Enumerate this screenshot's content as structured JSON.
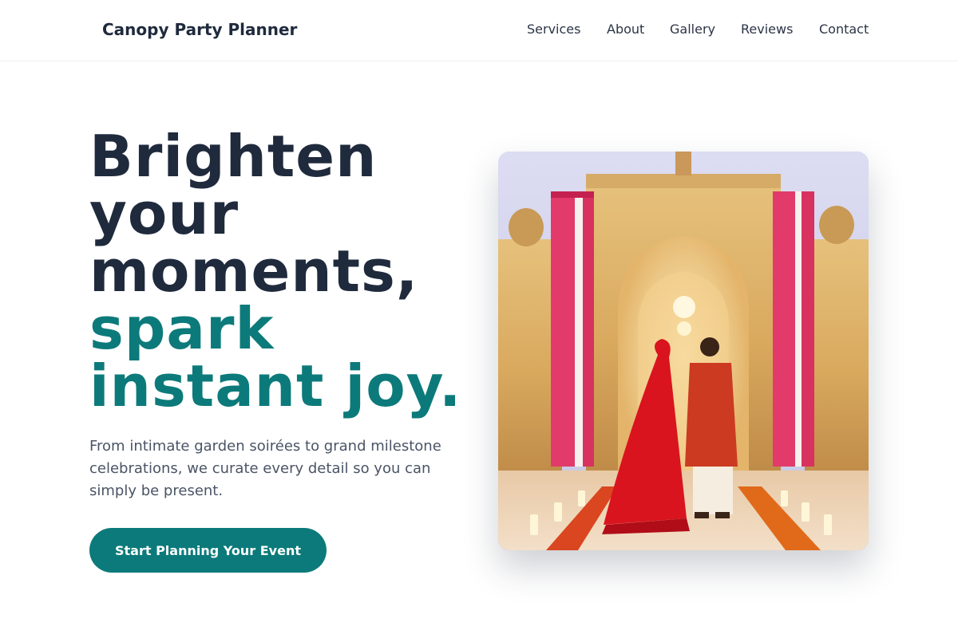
{
  "header": {
    "brand": "Canopy Party Planner",
    "nav": [
      "Services",
      "About",
      "Gallery",
      "Reviews",
      "Contact"
    ]
  },
  "hero": {
    "headline_lines": [
      "Brighten",
      "your",
      "moments,"
    ],
    "headline_accent_lines": [
      "spark",
      "instant joy."
    ],
    "subtext": "From intimate garden soirées to grand milestone celebrations, we curate every detail so you can simply be present.",
    "cta_label": "Start Planning Your Event"
  },
  "image": {
    "subject": "wedding couple under floral-decorated palace archway"
  },
  "colors": {
    "accent": "#0c7a7a",
    "heading": "#1f2a3d",
    "body_text": "#4a5466"
  }
}
